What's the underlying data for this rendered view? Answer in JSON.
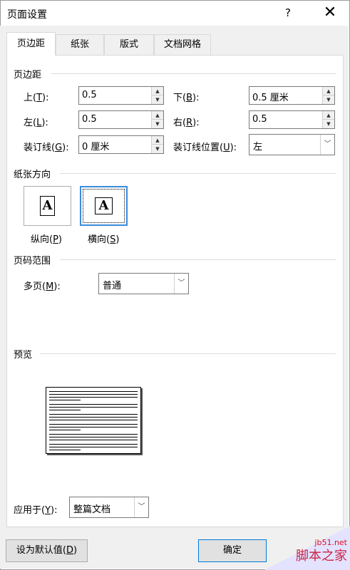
{
  "window": {
    "title": "页面设置",
    "help": "?",
    "close": "✕"
  },
  "tabs": [
    {
      "label": "页边距",
      "active": true
    },
    {
      "label": "纸张",
      "active": false
    },
    {
      "label": "版式",
      "active": false
    },
    {
      "label": "文档网格",
      "active": false
    }
  ],
  "margins": {
    "section_title": "页边距",
    "top": {
      "label_pre": "上(",
      "key": "T",
      "label_post": "):",
      "value": "0.5"
    },
    "bottom": {
      "label_pre": "下(",
      "key": "B",
      "label_post": "):",
      "value": "0.5 厘米"
    },
    "left": {
      "label_pre": "左(",
      "key": "L",
      "label_post": "):",
      "value": "0.5"
    },
    "right": {
      "label_pre": "右(",
      "key": "R",
      "label_post": "):",
      "value": "0.5"
    },
    "gutter": {
      "label_pre": "装订线(",
      "key": "G",
      "label_post": "):",
      "value": "0 厘米"
    },
    "gutter_position": {
      "label_pre": "装订线位置(",
      "key": "U",
      "label_post": "):",
      "value": "左"
    }
  },
  "orientation": {
    "section_title": "纸张方向",
    "portrait": {
      "label_pre": "纵向(",
      "key": "P",
      "label_post": ")",
      "glyph": "A"
    },
    "landscape": {
      "label_pre": "横向(",
      "key": "S",
      "label_post": ")",
      "glyph": "A"
    },
    "selected": "landscape"
  },
  "pages": {
    "section_title": "页码范围",
    "multiple": {
      "label_pre": "多页(",
      "key": "M",
      "label_post": "):",
      "value": "普通"
    }
  },
  "preview": {
    "section_title": "预览"
  },
  "apply_to": {
    "label_pre": "应用于(",
    "key": "Y",
    "label_post": "):",
    "value": "整篇文档"
  },
  "buttons": {
    "default_pre": "设为默认值(",
    "default_key": "D",
    "default_post": ")",
    "ok": "确定"
  },
  "icons": {
    "spin_up": "▲",
    "spin_down": "▼",
    "dropdown": "﹀"
  },
  "watermark": {
    "url": "jb51.net",
    "text": "脚本之家"
  },
  "colors": {
    "accent": "#0078d7",
    "selected_border": "#3c8bdb"
  }
}
